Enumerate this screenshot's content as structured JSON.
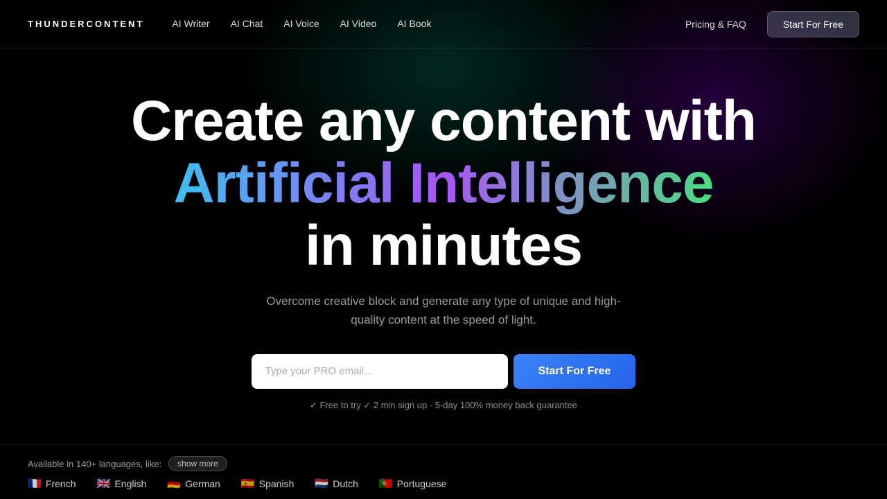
{
  "nav": {
    "logo": "THUNDERCONTENT",
    "links": [
      {
        "label": "AI Writer",
        "id": "ai-writer"
      },
      {
        "label": "AI Chat",
        "id": "ai-chat"
      },
      {
        "label": "AI Voice",
        "id": "ai-voice"
      },
      {
        "label": "AI Video",
        "id": "ai-video"
      },
      {
        "label": "AI Book",
        "id": "ai-book"
      }
    ],
    "pricing_label": "Pricing & FAQ",
    "cta_label": "Start For Free"
  },
  "hero": {
    "title_line1": "Create any content with",
    "title_line2": "Artificial Intelligence",
    "title_line3": "in minutes",
    "subtitle": "Overcome creative block and generate any type of unique and high-quality content at the speed of light.",
    "email_placeholder": "Type your PRO email...",
    "cta_label": "Start For Free",
    "guarantee": "✓ Free to try ✓ 2 min sign up · 5-day 100% money back guarantee"
  },
  "languages": {
    "label": "Available in 140+ languages, like:",
    "show_more_label": "show more",
    "items": [
      {
        "flag": "🇫🇷",
        "name": "French"
      },
      {
        "flag": "🇬🇧",
        "name": "English"
      },
      {
        "flag": "🇩🇪",
        "name": "German"
      },
      {
        "flag": "🇪🇸",
        "name": "Spanish"
      },
      {
        "flag": "🇳🇱",
        "name": "Dutch"
      },
      {
        "flag": "🇵🇹",
        "name": "Portuguese"
      }
    ]
  }
}
